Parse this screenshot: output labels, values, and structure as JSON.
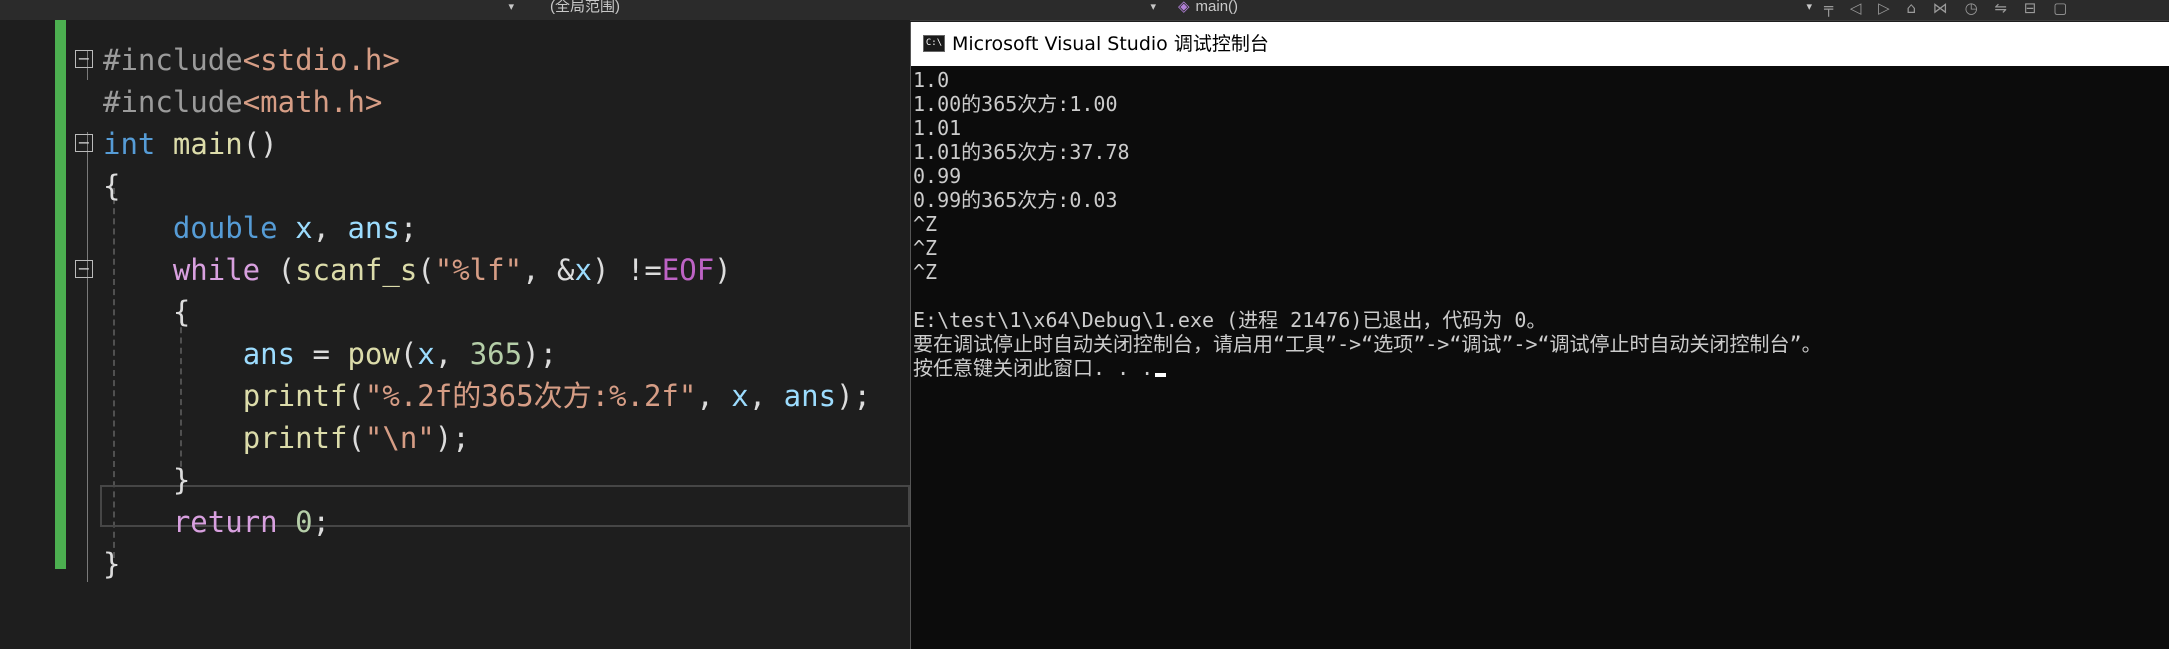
{
  "toolbar": {
    "project_dropdown": "",
    "scope_dropdown": "(全局范围)",
    "member_dropdown": "main()"
  },
  "editor": {
    "lines": [
      {
        "parts": [
          {
            "t": "#include",
            "c": "pp"
          },
          {
            "t": "<stdio.h>",
            "c": "inc"
          }
        ]
      },
      {
        "parts": [
          {
            "t": "#include",
            "c": "pp"
          },
          {
            "t": "<math.h>",
            "c": "inc"
          }
        ]
      },
      {
        "parts": [
          {
            "t": "int",
            "c": "kw"
          },
          {
            "t": " "
          },
          {
            "t": "main",
            "c": "fn"
          },
          {
            "t": "()"
          }
        ]
      },
      {
        "parts": [
          {
            "t": "{"
          }
        ]
      },
      {
        "parts": [
          {
            "t": "    "
          },
          {
            "t": "double",
            "c": "kw"
          },
          {
            "t": " "
          },
          {
            "t": "x",
            "c": "var"
          },
          {
            "t": ", "
          },
          {
            "t": "ans",
            "c": "var"
          },
          {
            "t": ";"
          }
        ]
      },
      {
        "parts": [
          {
            "t": "    "
          },
          {
            "t": "while",
            "c": "ctl"
          },
          {
            "t": " ("
          },
          {
            "t": "scanf_s",
            "c": "fn"
          },
          {
            "t": "("
          },
          {
            "t": "\"%lf\"",
            "c": "str"
          },
          {
            "t": ", &"
          },
          {
            "t": "x",
            "c": "var"
          },
          {
            "t": ") !="
          },
          {
            "t": "EOF",
            "c": "mac"
          },
          {
            "t": ")"
          }
        ]
      },
      {
        "parts": [
          {
            "t": "    {"
          }
        ]
      },
      {
        "parts": [
          {
            "t": "        "
          },
          {
            "t": "ans",
            "c": "var"
          },
          {
            "t": " = "
          },
          {
            "t": "pow",
            "c": "fn"
          },
          {
            "t": "("
          },
          {
            "t": "x",
            "c": "var"
          },
          {
            "t": ", "
          },
          {
            "t": "365",
            "c": "num"
          },
          {
            "t": ");"
          }
        ]
      },
      {
        "parts": [
          {
            "t": "        "
          },
          {
            "t": "printf",
            "c": "fn"
          },
          {
            "t": "("
          },
          {
            "t": "\"%.2f的365次方:%.2f\"",
            "c": "str"
          },
          {
            "t": ", "
          },
          {
            "t": "x",
            "c": "var"
          },
          {
            "t": ", "
          },
          {
            "t": "ans",
            "c": "var"
          },
          {
            "t": ");"
          }
        ]
      },
      {
        "parts": [
          {
            "t": "        "
          },
          {
            "t": "printf",
            "c": "fn"
          },
          {
            "t": "("
          },
          {
            "t": "\"\\n\"",
            "c": "str"
          },
          {
            "t": ");"
          }
        ]
      },
      {
        "parts": [
          {
            "t": "    }"
          }
        ]
      },
      {
        "parts": [
          {
            "t": "    "
          },
          {
            "t": "return",
            "c": "ctl"
          },
          {
            "t": " "
          },
          {
            "t": "0",
            "c": "num"
          },
          {
            "t": ";"
          }
        ]
      },
      {
        "parts": [
          {
            "t": "}"
          }
        ]
      }
    ]
  },
  "console": {
    "title": "Microsoft Visual Studio 调试控制台",
    "icon_label": "C:\\",
    "lines": [
      "1.0",
      "1.00的365次方:1.00",
      "1.01",
      "1.01的365次方:37.78",
      "0.99",
      "0.99的365次方:0.03",
      "^Z",
      "^Z",
      "^Z",
      "",
      "E:\\test\\1\\x64\\Debug\\1.exe (进程 21476)已退出，代码为 0。",
      "要在调试停止时自动关闭控制台，请启用“工具”->“选项”->“调试”->“调试停止时自动关闭控制台”。",
      "按任意键关闭此窗口. . ."
    ]
  },
  "colors": {
    "editor_bg": "#1e1e1e",
    "console_bg": "#0c0c0c",
    "change_bar": "#4caf50",
    "keyword": "#569cd6",
    "control": "#d8a0df",
    "function": "#dcdcaa",
    "string": "#d69d85",
    "variable": "#9cdcfe",
    "number": "#b5cea8"
  }
}
